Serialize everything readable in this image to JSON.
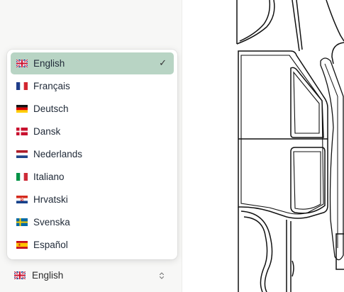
{
  "language_menu": {
    "items": [
      {
        "label": "English",
        "flag": "gb",
        "selected": true
      },
      {
        "label": "Français",
        "flag": "fr"
      },
      {
        "label": "Deutsch",
        "flag": "de"
      },
      {
        "label": "Dansk",
        "flag": "dk"
      },
      {
        "label": "Nederlands",
        "flag": "nl"
      },
      {
        "label": "Italiano",
        "flag": "it"
      },
      {
        "label": "Hrvatski",
        "flag": "hr"
      },
      {
        "label": "Svenska",
        "flag": "se"
      },
      {
        "label": "Español",
        "flag": "es"
      }
    ],
    "check_glyph": "✓"
  },
  "language_select": {
    "value": "English",
    "flag": "gb",
    "icon": "chevron-up-down-icon"
  }
}
